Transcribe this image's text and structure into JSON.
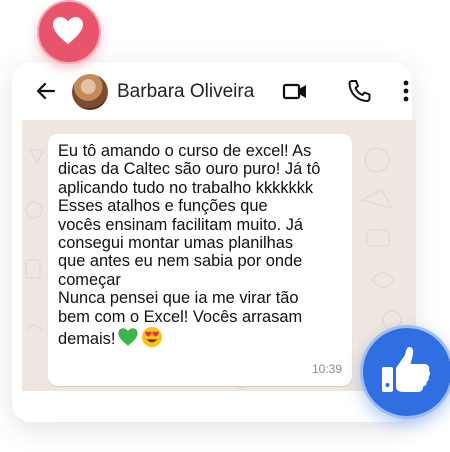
{
  "contact": {
    "name": "Barbara Oliveira"
  },
  "message": {
    "text": "Eu tô amando o curso de excel! As\ndicas da Caltec são ouro puro! Já tô\naplicando tudo no trabalho kkkkkkk\nEsses atalhos e funções que\nvocês ensinam facilitam muito. Já\nconsegui montar umas planilhas\nque antes eu nem sabia por onde\ncomeçar\nNunca pensei que ia me virar tão\nbem com o Excel! Vocês arrasam\ndemais!",
    "time": "10:39",
    "emojis": [
      "green-heart-icon",
      "heart-eyes-icon"
    ]
  },
  "colors": {
    "chat_background": "#efe7df",
    "heart_badge": "#e8546c",
    "like_badge": "#2f6fe2"
  }
}
